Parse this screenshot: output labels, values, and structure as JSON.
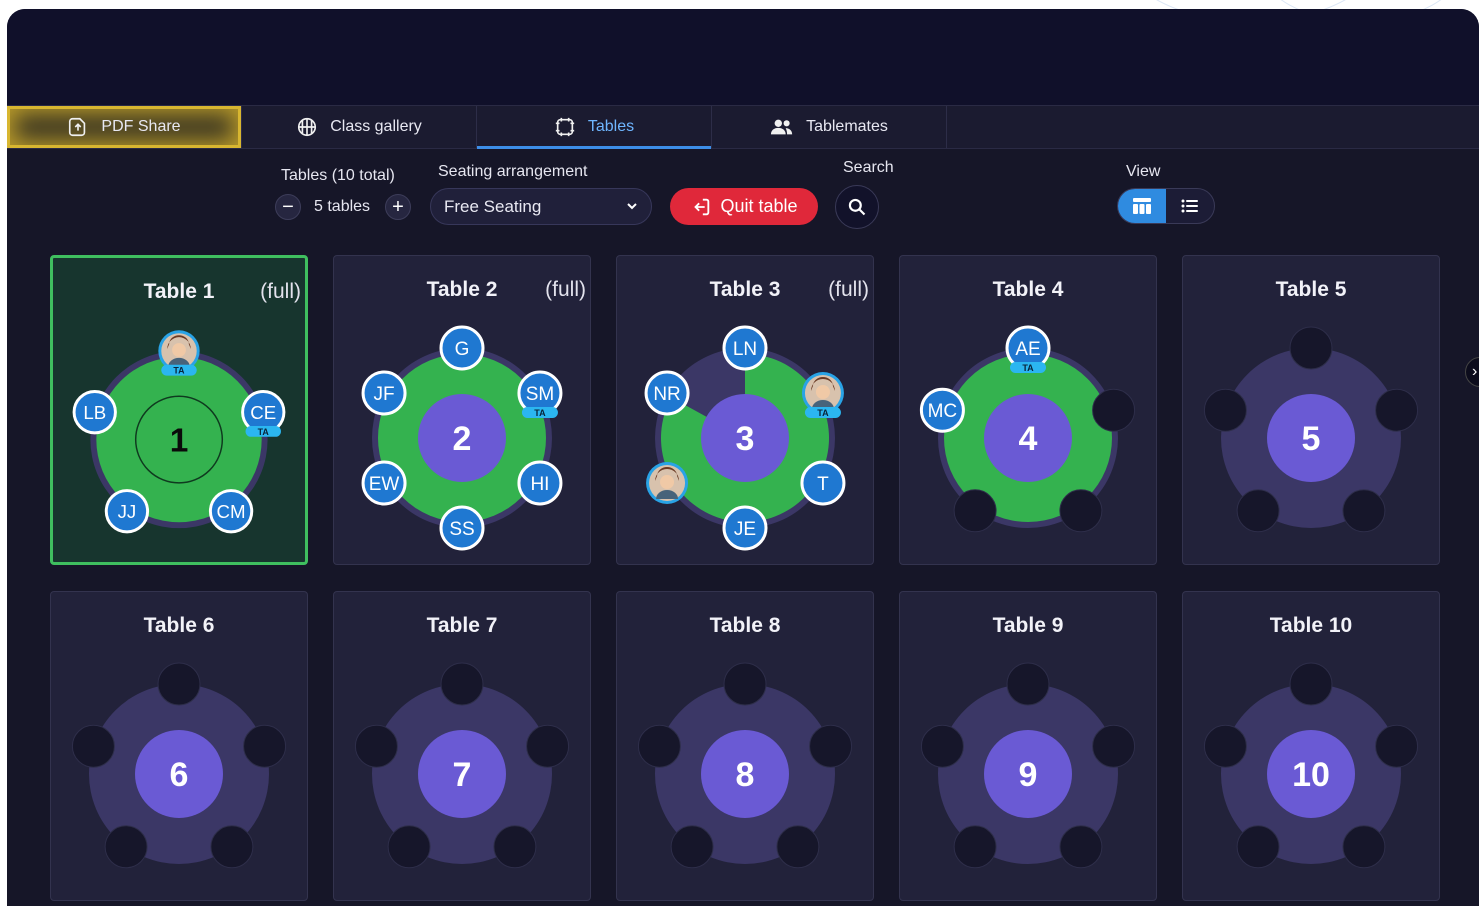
{
  "tabs": [
    {
      "label": "PDF Share",
      "icon": "pdf-share-icon",
      "state": "highlighted"
    },
    {
      "label": "Class gallery",
      "icon": "gallery-grid-icon",
      "state": "normal"
    },
    {
      "label": "Tables",
      "icon": "tables-icon",
      "state": "active"
    },
    {
      "label": "Tablemates",
      "icon": "people-icon",
      "state": "normal"
    }
  ],
  "toolbar": {
    "tables_label": "Tables (10 total)",
    "table_count_value": "5 tables",
    "seating_label": "Seating arrangement",
    "seating_value": "Free Seating",
    "quit_label": "Quit table",
    "search_label": "Search",
    "view_label": "View"
  },
  "colors": {
    "occupied": "#34b24f",
    "table_center": "#6a5ad4",
    "ring_empty": "#3b3766",
    "avatar_blue": "#1f78d1",
    "quit_red": "#e0283a",
    "accent_blue": "#2f8be0",
    "selected_border": "#3fbf5f"
  },
  "badge_text": "TA",
  "tables": [
    {
      "name": "Table 1",
      "number": "1",
      "status": "(full)",
      "selected": true,
      "fill": 1,
      "seats": [
        {
          "initials": "",
          "photo": true,
          "ta": true
        },
        {
          "initials": "CE",
          "ta": true
        },
        {
          "initials": "CM"
        },
        {
          "initials": "JJ"
        },
        {
          "initials": "LB"
        }
      ]
    },
    {
      "name": "Table 2",
      "number": "2",
      "status": "(full)",
      "selected": false,
      "fill": 1,
      "seats": [
        {
          "initials": "G"
        },
        {
          "initials": "SM",
          "ta": true
        },
        {
          "initials": "HI"
        },
        {
          "initials": "SS"
        },
        {
          "initials": "EW"
        },
        {
          "initials": "JF"
        }
      ]
    },
    {
      "name": "Table 3",
      "number": "3",
      "status": "(full)",
      "selected": false,
      "fill": 0.83,
      "seats": [
        {
          "initials": "LN"
        },
        {
          "initials": "",
          "photo": true,
          "ta": true
        },
        {
          "initials": "T"
        },
        {
          "initials": "JE"
        },
        {
          "initials": "",
          "photo": true
        },
        {
          "initials": "NR"
        }
      ]
    },
    {
      "name": "Table 4",
      "number": "4",
      "status": "",
      "selected": false,
      "fill": 1,
      "seats": [
        {
          "initials": "AE",
          "ta": true
        },
        {
          "initials": ""
        },
        {
          "initials": ""
        },
        {
          "initials": ""
        },
        {
          "initials": "MC"
        }
      ]
    },
    {
      "name": "Table 5",
      "number": "5",
      "status": "",
      "selected": false,
      "fill": 0,
      "seats": [
        {
          "initials": ""
        },
        {
          "initials": ""
        },
        {
          "initials": ""
        },
        {
          "initials": ""
        },
        {
          "initials": ""
        }
      ]
    },
    {
      "name": "Table 6",
      "number": "6",
      "status": "",
      "selected": false,
      "fill": 0,
      "seats": [
        {
          "initials": ""
        },
        {
          "initials": ""
        },
        {
          "initials": ""
        },
        {
          "initials": ""
        },
        {
          "initials": ""
        }
      ]
    },
    {
      "name": "Table 7",
      "number": "7",
      "status": "",
      "selected": false,
      "fill": 0,
      "seats": [
        {
          "initials": ""
        },
        {
          "initials": ""
        },
        {
          "initials": ""
        },
        {
          "initials": ""
        },
        {
          "initials": ""
        }
      ]
    },
    {
      "name": "Table 8",
      "number": "8",
      "status": "",
      "selected": false,
      "fill": 0,
      "seats": [
        {
          "initials": ""
        },
        {
          "initials": ""
        },
        {
          "initials": ""
        },
        {
          "initials": ""
        },
        {
          "initials": ""
        }
      ]
    },
    {
      "name": "Table 9",
      "number": "9",
      "status": "",
      "selected": false,
      "fill": 0,
      "seats": [
        {
          "initials": ""
        },
        {
          "initials": ""
        },
        {
          "initials": ""
        },
        {
          "initials": ""
        },
        {
          "initials": ""
        }
      ]
    },
    {
      "name": "Table 10",
      "number": "10",
      "status": "",
      "selected": false,
      "fill": 0,
      "seats": [
        {
          "initials": ""
        },
        {
          "initials": ""
        },
        {
          "initials": ""
        },
        {
          "initials": ""
        },
        {
          "initials": ""
        }
      ]
    }
  ]
}
